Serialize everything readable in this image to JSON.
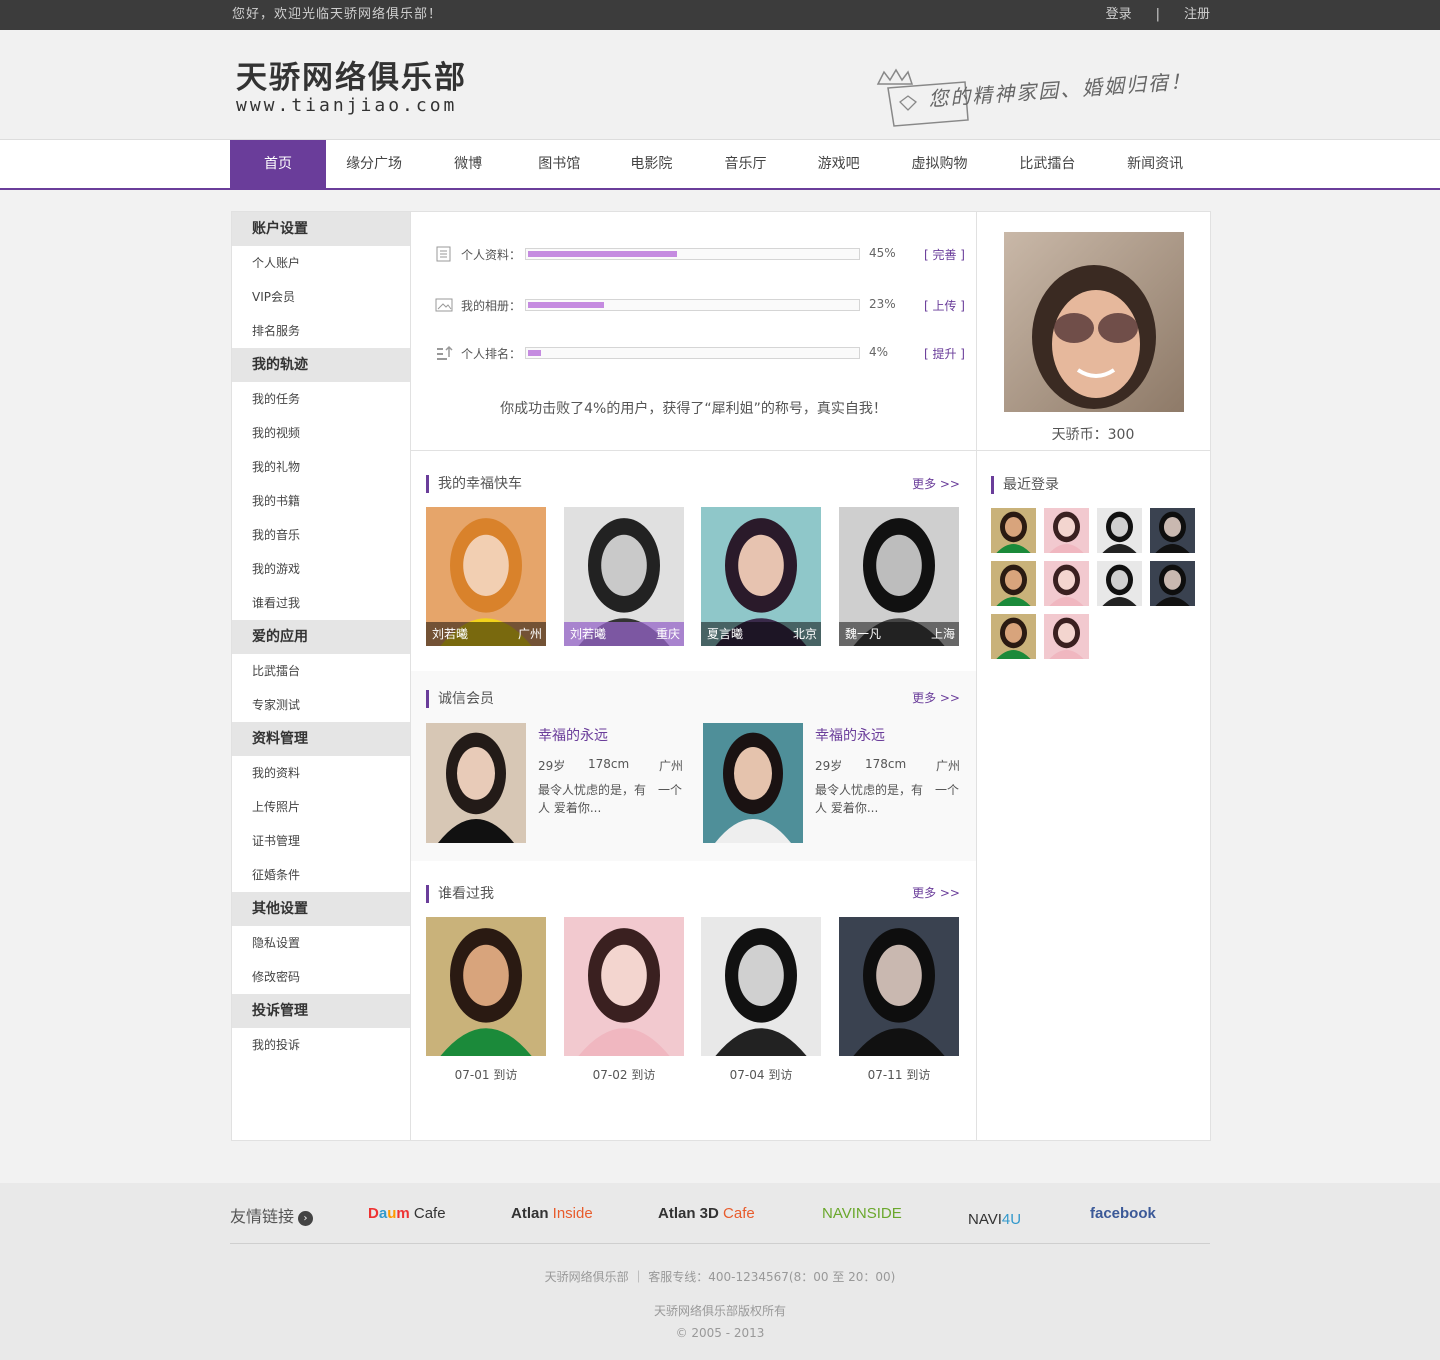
{
  "topbar": {
    "welcome": "您好，欢迎光临天骄网络俱乐部！",
    "login": "登录",
    "separator": "|",
    "register": "注册"
  },
  "header": {
    "logo_cn": "天骄网络俱乐部",
    "logo_en": "www.tianjiao.com",
    "slogan": "您的精神家园、婚姻归宿！"
  },
  "nav": {
    "items": [
      "首页",
      "缘分广场",
      "微博",
      "图书馆",
      "电影院",
      "音乐厅",
      "游戏吧",
      "虚拟购物",
      "比武擂台",
      "新闻资讯"
    ]
  },
  "sidebar": {
    "groups": [
      {
        "title": "账户设置",
        "items": [
          "个人账户",
          "VIP会员",
          "排名服务"
        ]
      },
      {
        "title": "我的轨迹",
        "items": [
          "我的任务",
          "我的视频",
          "我的礼物",
          "我的书籍",
          "我的音乐",
          "我的游戏",
          "谁看过我"
        ]
      },
      {
        "title": "爱的应用",
        "items": [
          "比武擂台",
          "专家测试"
        ]
      },
      {
        "title": "资料管理",
        "items": [
          "我的资料",
          "上传照片",
          "证书管理",
          "征婚条件"
        ]
      },
      {
        "title": "其他设置",
        "items": [
          "隐私设置",
          "修改密码"
        ]
      },
      {
        "title": "投诉管理",
        "items": [
          "我的投诉"
        ]
      }
    ]
  },
  "progress": {
    "rows": [
      {
        "label": "个人资料：",
        "percent": 45,
        "percent_text": "45%",
        "action": "[ 完善 ]"
      },
      {
        "label": "我的相册：",
        "percent": 23,
        "percent_text": "23%",
        "action": "[ 上传 ]"
      },
      {
        "label": "个人排名：",
        "percent": 4,
        "percent_text": "4%",
        "action": "[ 提升 ]"
      }
    ],
    "message": "你成功击败了4%的用户，获得了“犀利姐”的称号，真实自我！"
  },
  "happy_express": {
    "title": "我的幸福快车",
    "more": "更多 >>",
    "people": [
      {
        "name": "刘若曦",
        "city": "广州"
      },
      {
        "name": "刘若曦",
        "city": "重庆"
      },
      {
        "name": "夏言曦",
        "city": "北京"
      },
      {
        "name": "魏一凡",
        "city": "上海"
      }
    ]
  },
  "trusted_members": {
    "title": "诚信会员",
    "more": "更多 >>",
    "members": [
      {
        "name": "幸福的永远",
        "age": "29岁",
        "height": "178cm",
        "city": "广州",
        "desc": "最令人忧虑的是，有　一个人 爱着你..."
      },
      {
        "name": "幸福的永远",
        "age": "29岁",
        "height": "178cm",
        "city": "广州",
        "desc": "最令人忧虑的是，有　一个人 爱着你..."
      }
    ]
  },
  "visitors": {
    "title": "谁看过我",
    "more": "更多 >>",
    "dates": [
      "07-01 到访",
      "07-02 到访",
      "07-04 到访",
      "07-11 到访"
    ]
  },
  "profile": {
    "coins": "天骄币：300"
  },
  "recent_login": {
    "title": "最近登录"
  },
  "footer": {
    "links_title": "友情链接",
    "logos": [
      "Daum Cafe",
      "Atlan Inside",
      "Atlan 3D Cafe",
      "NAVINSIDE",
      "NAVI4U",
      "facebook"
    ],
    "info": "天骄网络俱乐部 ｜ 客服专线：400-1234567(8：00 至 20：00)",
    "rights": "天骄网络俱乐部版权所有",
    "copyright": "© 2005 - 2013"
  },
  "colors": {
    "accent": "#6a3d9a",
    "progress_fill": "#c58be0",
    "topbar": "#3c3c3c"
  }
}
